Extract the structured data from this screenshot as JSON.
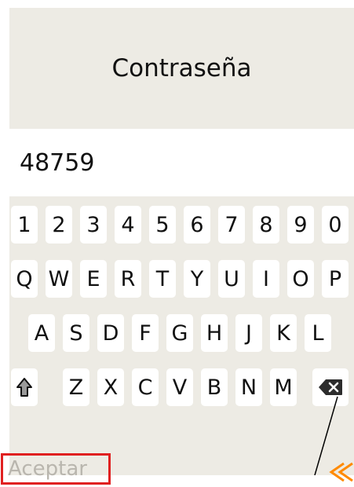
{
  "dialog": {
    "title": "Contraseña",
    "password_value": "48759",
    "accept_label": "Aceptar"
  },
  "keyboard": {
    "row1": [
      "1",
      "2",
      "3",
      "4",
      "5",
      "6",
      "7",
      "8",
      "9",
      "0"
    ],
    "row2": [
      "Q",
      "W",
      "E",
      "R",
      "T",
      "Y",
      "U",
      "I",
      "O",
      "P"
    ],
    "row3": [
      "A",
      "S",
      "D",
      "F",
      "G",
      "H",
      "J",
      "K",
      "L"
    ],
    "row4": [
      "Z",
      "X",
      "C",
      "V",
      "B",
      "N",
      "M"
    ],
    "shift_icon": "shift-arrow-up-icon",
    "backspace_icon": "backspace-icon"
  },
  "icons": {
    "back": "double-chevron-left-icon"
  },
  "colors": {
    "panel_background": "#edebe4",
    "key_background": "#ffffff",
    "accept_border": "#e02020",
    "accept_text": "#b9b6ae",
    "back_icon": "#ff8a00"
  }
}
